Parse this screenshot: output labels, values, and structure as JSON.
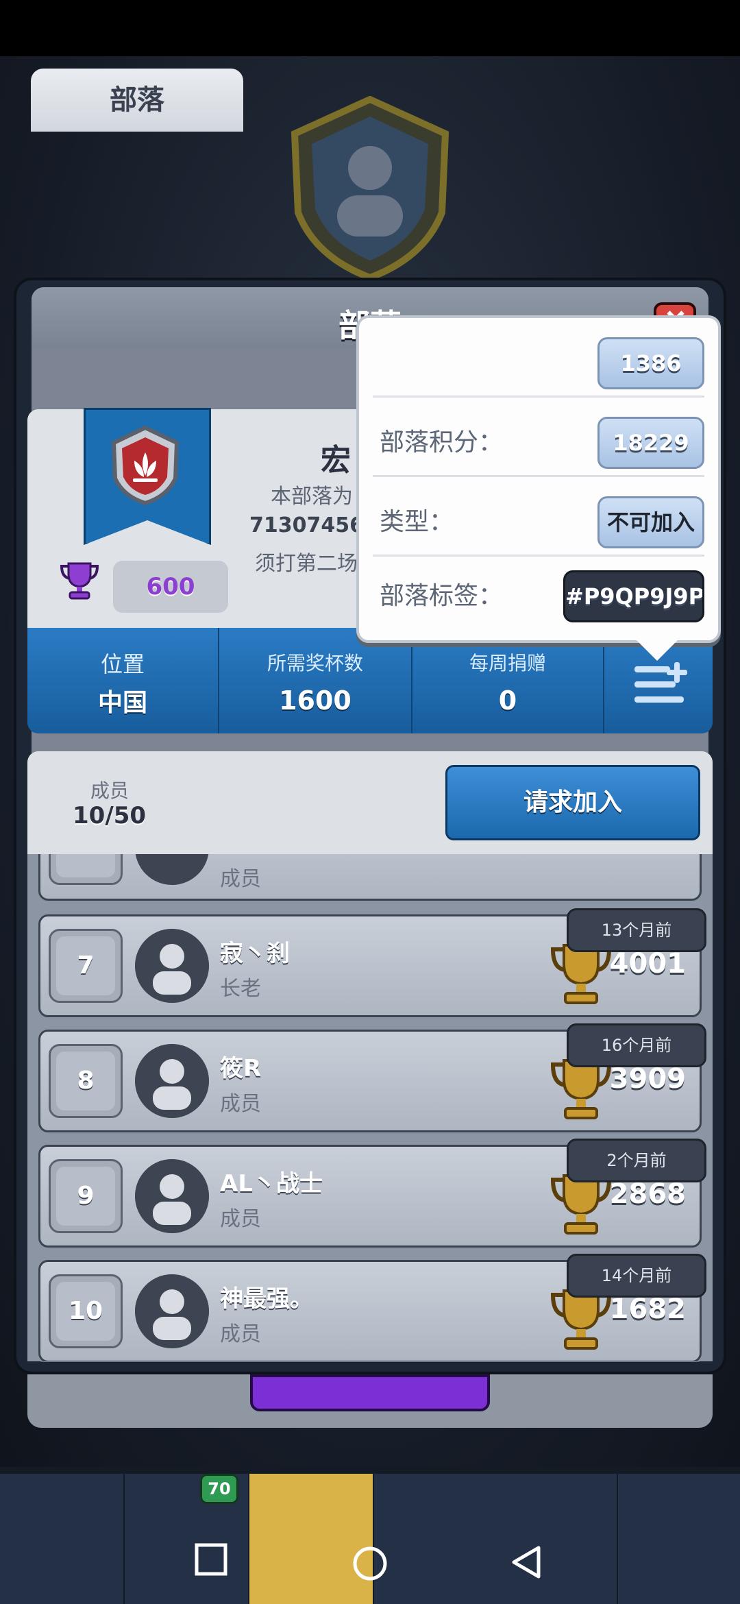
{
  "panel": {
    "title": "部落",
    "tab_label": "部落",
    "clan_name": "宏",
    "description_lines": [
      "本部落为",
      "71307456",
      "须打第二场"
    ],
    "required_trophies_badge": "600"
  },
  "stats": {
    "location_label": "位置",
    "location_value": "中国",
    "required_trophies_label": "所需奖杯数",
    "required_trophies_value": "1600",
    "weekly_donations_label": "每周捐赠",
    "weekly_donations_value": "0"
  },
  "members_header": {
    "label": "成员",
    "count": "10/50",
    "join_button": "请求加入"
  },
  "partial_member": {
    "role": "成员"
  },
  "members": [
    {
      "rank": "7",
      "name": "寂丶刹",
      "role": "长老",
      "trophies": "4001",
      "last_seen": "13个月前"
    },
    {
      "rank": "8",
      "name": "筱R",
      "role": "成员",
      "trophies": "3909",
      "last_seen": "16个月前"
    },
    {
      "rank": "9",
      "name": "AL丶战士",
      "role": "成员",
      "trophies": "2868",
      "last_seen": "2个月前"
    },
    {
      "rank": "10",
      "name": "神最强。",
      "role": "成员",
      "trophies": "1682",
      "last_seen": "14个月前"
    }
  ],
  "popup": {
    "row1_value": "1386",
    "clan_score_label": "部落积分：",
    "clan_score_value": "18229",
    "type_label": "类型：",
    "type_value": "不可加入",
    "tag_label": "部落标签：",
    "tag_value": "#P9QP9J9P"
  },
  "nav": {
    "badge": "70"
  },
  "colors": {
    "accent_blue": "#1f6fb7",
    "close_red": "#d6443d",
    "purple": "#7c2fd4",
    "gold": "#d9b348"
  }
}
